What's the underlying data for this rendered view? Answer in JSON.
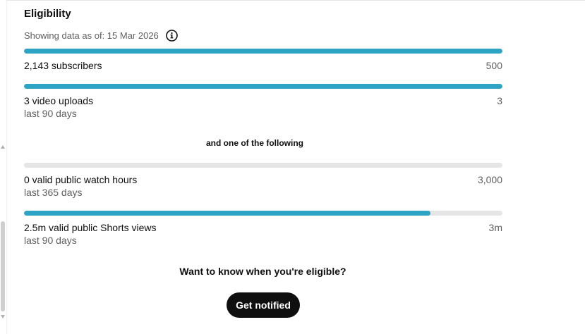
{
  "title": "Eligibility",
  "data_as_of": "Showing data as of: 15 Mar 2026",
  "colors": {
    "bar_fill": "#2ea4c5",
    "bar_track": "#e5e5e5",
    "button_bg": "#0f0f0f"
  },
  "requirements": [
    {
      "label": "2,143 subscribers",
      "sub": "",
      "target": "500",
      "progress": 1.0
    },
    {
      "label": "3 video uploads",
      "sub": "last 90 days",
      "target": "3",
      "progress": 1.0
    }
  ],
  "separator": "and one of the following",
  "alternatives": [
    {
      "label": "0 valid public watch hours",
      "sub": "last 365 days",
      "target": "3,000",
      "progress": 0.0
    },
    {
      "label": "2.5m valid public Shorts views",
      "sub": "last 90 days",
      "target": "3m",
      "progress": 0.85
    }
  ],
  "cta": {
    "question": "Want to know when you're eligible?",
    "button_label": "Get notified"
  }
}
